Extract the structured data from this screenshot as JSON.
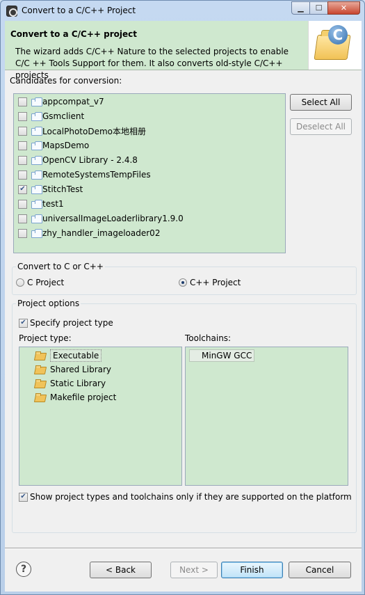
{
  "window": {
    "title": "Convert to a C/C++ Project",
    "minimize_glyph": "▁",
    "maximize_glyph": "☐",
    "close_glyph": "✕"
  },
  "banner": {
    "title": "Convert to a C/C++ project",
    "description": "The wizard adds C/C++ Nature to the selected projects to enable C/C ++ Tools Support for them. It also converts old-style C/C++ projects",
    "image_letter": "C"
  },
  "candidates": {
    "label": "Candidates for conversion:",
    "items": [
      {
        "label": "appcompat_v7",
        "checked": false
      },
      {
        "label": "Gsmclient",
        "checked": false
      },
      {
        "label": "LocalPhotoDemo本地相册",
        "checked": false
      },
      {
        "label": "MapsDemo",
        "checked": false
      },
      {
        "label": "OpenCV Library - 2.4.8",
        "checked": false
      },
      {
        "label": "RemoteSystemsTempFiles",
        "checked": false
      },
      {
        "label": "StitchTest",
        "checked": true
      },
      {
        "label": "test1",
        "checked": false
      },
      {
        "label": "universalImageLoaderlibrary1.9.0",
        "checked": false
      },
      {
        "label": "zhy_handler_imageloader02",
        "checked": false
      }
    ],
    "select_all": "Select All",
    "deselect_all": "Deselect All"
  },
  "convert_group": {
    "title": "Convert to C or C++",
    "c_project": "C Project",
    "cpp_project": "C++ Project",
    "selected": "cpp"
  },
  "project_options": {
    "title": "Project options",
    "specify_type": "Specify project type",
    "project_type_label": "Project type:",
    "toolchains_label": "Toolchains:",
    "types": [
      "Executable",
      "Shared Library",
      "Static Library",
      "Makefile project"
    ],
    "toolchains": [
      "MinGW GCC"
    ],
    "show_supported": "Show project types and toolchains only if they are supported on the platform"
  },
  "footer": {
    "help_glyph": "?",
    "back": "< Back",
    "next": "Next >",
    "finish": "Finish",
    "cancel": "Cancel"
  }
}
